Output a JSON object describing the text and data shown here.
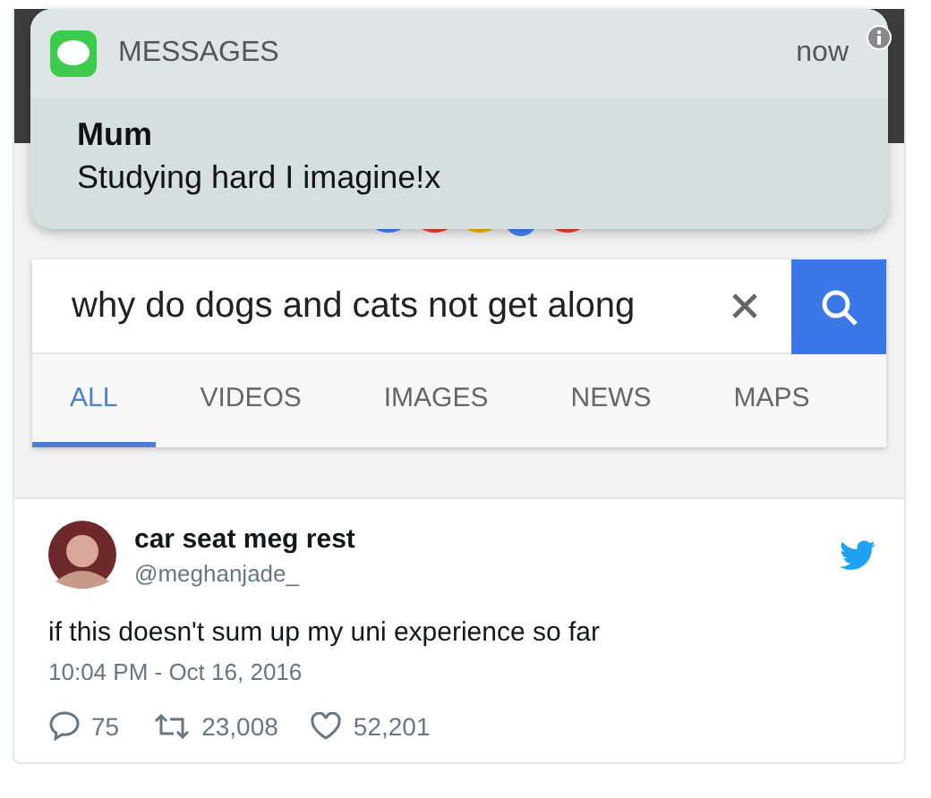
{
  "notification": {
    "app": "MESSAGES",
    "time": "now",
    "sender": "Mum",
    "message": "Studying hard I imagine!x"
  },
  "search": {
    "value": "why do dogs and cats not get along"
  },
  "tabs": [
    {
      "label": "ALL",
      "selected": true
    },
    {
      "label": "VIDEOS",
      "selected": false
    },
    {
      "label": "IMAGES",
      "selected": false
    },
    {
      "label": "NEWS",
      "selected": false
    },
    {
      "label": "MAPS",
      "selected": false
    }
  ],
  "tweet": {
    "name": "car seat meg rest",
    "handle": "@meghanjade_",
    "text": "if this doesn't sum up my uni experience so far",
    "timestamp": "10:04 PM - Oct 16, 2016",
    "replies": "75",
    "retweets": "23,008",
    "likes": "52,201"
  }
}
